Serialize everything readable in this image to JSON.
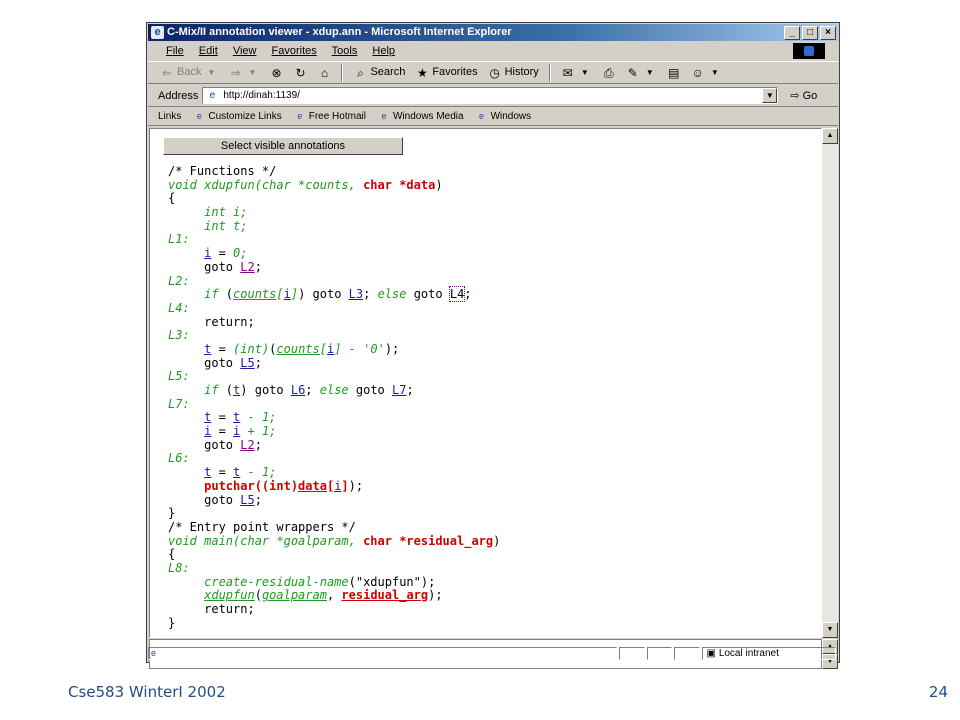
{
  "window": {
    "title": "C-Mix/II annotation viewer - xdup.ann - Microsoft Internet Explorer",
    "buttons": [
      "_",
      "□",
      "×"
    ]
  },
  "menu": [
    "File",
    "Edit",
    "View",
    "Favorites",
    "Tools",
    "Help"
  ],
  "toolbar": {
    "back": "Back",
    "search": "Search",
    "favorites": "Favorites",
    "history": "History"
  },
  "address": {
    "label": "Address",
    "url": "http://dinah:1139/",
    "go": "Go"
  },
  "links": {
    "label": "Links",
    "items": [
      "Customize Links",
      "Free Hotmail",
      "Windows Media",
      "Windows"
    ]
  },
  "content": {
    "select_button": "Select visible annotations"
  },
  "code_lines": [
    [
      {
        "t": "/* Functions */",
        "s": ""
      }
    ],
    [
      {
        "t": "void xdupfun(char *counts, ",
        "s": "g"
      },
      {
        "t": "char *data",
        "s": "r"
      },
      {
        "t": ")",
        "s": ""
      }
    ],
    [
      {
        "t": "{",
        "s": ""
      }
    ],
    [
      {
        "t": "     ",
        "s": ""
      },
      {
        "t": "int i;",
        "s": "g"
      }
    ],
    [
      {
        "t": "     ",
        "s": ""
      },
      {
        "t": "int t;",
        "s": "g"
      }
    ],
    [
      {
        "t": "L1:",
        "s": "g"
      }
    ],
    [
      {
        "t": "     ",
        "s": ""
      },
      {
        "t": "i",
        "s": "b"
      },
      {
        "t": " = ",
        "s": ""
      },
      {
        "t": "0;",
        "s": "g"
      }
    ],
    [
      {
        "t": "     goto ",
        "s": ""
      },
      {
        "t": "L2",
        "s": "m"
      },
      {
        "t": ";",
        "s": ""
      }
    ],
    [
      {
        "t": "L2:",
        "s": "g"
      }
    ],
    [
      {
        "t": "     ",
        "s": ""
      },
      {
        "t": "if",
        "s": "g"
      },
      {
        "t": " (",
        "s": ""
      },
      {
        "t": "counts",
        "s": "gu"
      },
      {
        "t": "[",
        "s": "g"
      },
      {
        "t": "i",
        "s": "b"
      },
      {
        "t": "]",
        "s": "g"
      },
      {
        "t": ") goto ",
        "s": ""
      },
      {
        "t": "L3",
        "s": "b"
      },
      {
        "t": "; ",
        "s": ""
      },
      {
        "t": "else",
        "s": "g"
      },
      {
        "t": " goto ",
        "s": ""
      },
      {
        "t": "L4",
        "s": "boxed"
      },
      {
        "t": ";",
        "s": ""
      }
    ],
    [
      {
        "t": "L4:",
        "s": "g"
      }
    ],
    [
      {
        "t": "     return;",
        "s": ""
      }
    ],
    [
      {
        "t": "L3:",
        "s": "g"
      }
    ],
    [
      {
        "t": "     ",
        "s": ""
      },
      {
        "t": "t",
        "s": "b"
      },
      {
        "t": " = ",
        "s": ""
      },
      {
        "t": "(int)",
        "s": "g"
      },
      {
        "t": "(",
        "s": ""
      },
      {
        "t": "counts",
        "s": "gu"
      },
      {
        "t": "[",
        "s": "g"
      },
      {
        "t": "i",
        "s": "b"
      },
      {
        "t": "] - '0'",
        "s": "g"
      },
      {
        "t": ");",
        "s": ""
      }
    ],
    [
      {
        "t": "     goto ",
        "s": ""
      },
      {
        "t": "L5",
        "s": "b"
      },
      {
        "t": ";",
        "s": ""
      }
    ],
    [
      {
        "t": "L5:",
        "s": "g"
      }
    ],
    [
      {
        "t": "     ",
        "s": ""
      },
      {
        "t": "if",
        "s": "g"
      },
      {
        "t": " (",
        "s": ""
      },
      {
        "t": "t",
        "s": "b"
      },
      {
        "t": ") goto ",
        "s": ""
      },
      {
        "t": "L6",
        "s": "b"
      },
      {
        "t": "; ",
        "s": ""
      },
      {
        "t": "else",
        "s": "g"
      },
      {
        "t": " goto ",
        "s": ""
      },
      {
        "t": "L7",
        "s": "b"
      },
      {
        "t": ";",
        "s": ""
      }
    ],
    [
      {
        "t": "L7:",
        "s": "g"
      }
    ],
    [
      {
        "t": "     ",
        "s": ""
      },
      {
        "t": "t",
        "s": "b"
      },
      {
        "t": " = ",
        "s": ""
      },
      {
        "t": "t",
        "s": "b"
      },
      {
        "t": " - 1;",
        "s": "g"
      }
    ],
    [
      {
        "t": "     ",
        "s": ""
      },
      {
        "t": "i",
        "s": "b"
      },
      {
        "t": " = ",
        "s": ""
      },
      {
        "t": "i",
        "s": "b"
      },
      {
        "t": " + 1;",
        "s": "g"
      }
    ],
    [
      {
        "t": "     goto ",
        "s": ""
      },
      {
        "t": "L2",
        "s": "m"
      },
      {
        "t": ";",
        "s": ""
      }
    ],
    [
      {
        "t": "L6:",
        "s": "g"
      }
    ],
    [
      {
        "t": "     ",
        "s": ""
      },
      {
        "t": "t",
        "s": "b"
      },
      {
        "t": " = ",
        "s": ""
      },
      {
        "t": "t",
        "s": "b"
      },
      {
        "t": " - 1;",
        "s": "g"
      }
    ],
    [
      {
        "t": "     ",
        "s": ""
      },
      {
        "t": "putchar((int)",
        "s": "r"
      },
      {
        "t": "data",
        "s": "ru"
      },
      {
        "t": "[",
        "s": "r"
      },
      {
        "t": "i",
        "s": "b"
      },
      {
        "t": "]",
        "s": "r"
      },
      {
        "t": ");",
        "s": ""
      }
    ],
    [
      {
        "t": "     goto ",
        "s": ""
      },
      {
        "t": "L5",
        "s": "b"
      },
      {
        "t": ";",
        "s": ""
      }
    ],
    [
      {
        "t": "}",
        "s": ""
      }
    ],
    [
      {
        "t": "/* Entry point wrappers */",
        "s": ""
      }
    ],
    [
      {
        "t": "void main(char *goalparam, ",
        "s": "g"
      },
      {
        "t": "char *residual_arg",
        "s": "r"
      },
      {
        "t": ")",
        "s": ""
      }
    ],
    [
      {
        "t": "{",
        "s": ""
      }
    ],
    [
      {
        "t": "L8:",
        "s": "g"
      }
    ],
    [
      {
        "t": "     ",
        "s": ""
      },
      {
        "t": "create-residual-name",
        "s": "g"
      },
      {
        "t": "(\"xdupfun\");",
        "s": ""
      }
    ],
    [
      {
        "t": "     ",
        "s": ""
      },
      {
        "t": "xdupfun",
        "s": "gu"
      },
      {
        "t": "(",
        "s": ""
      },
      {
        "t": "goalparam",
        "s": "gu"
      },
      {
        "t": ", ",
        "s": ""
      },
      {
        "t": "residual_arg",
        "s": "ru"
      },
      {
        "t": ");",
        "s": ""
      }
    ],
    [
      {
        "t": "     return;",
        "s": ""
      }
    ],
    [
      {
        "t": "}",
        "s": ""
      }
    ]
  ],
  "status": {
    "zone": "Local intranet"
  },
  "footer": {
    "left": "Cse583 WinterI 2002",
    "right": "24"
  }
}
